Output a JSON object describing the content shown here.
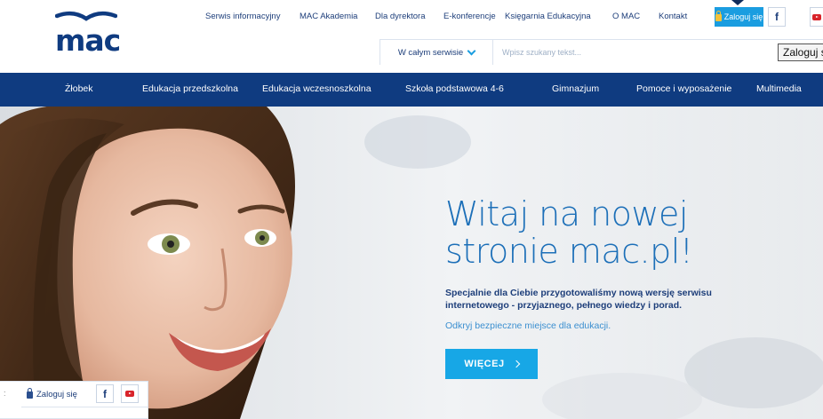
{
  "brand": {
    "logo_text": "mac",
    "primary_color": "#0f3b80",
    "accent_color": "#17a7e6"
  },
  "topnav": {
    "items": [
      "Serwis informacyjny",
      "MAC Akademia",
      "Dla dyrektora",
      "E-konferencje",
      "Księgarnia Edukacyjna",
      "O MAC",
      "Kontakt"
    ],
    "login_label": "Zaloguj się",
    "facebook_icon": "facebook-icon",
    "youtube_icon": "youtube-icon"
  },
  "search": {
    "scope_label": "W całym serwisie",
    "placeholder": "Wpisz szukany tekst...",
    "login_box_text": "Zaloguj się"
  },
  "mainnav": {
    "items": [
      "Żłobek",
      "Edukacja przedszkolna",
      "Edukacja wczesnoszkolna",
      "Szkoła podstawowa 4-6",
      "Gimnazjum",
      "Pomoce i wyposażenie",
      "Multimedia"
    ]
  },
  "hero": {
    "title_line1": "Witaj na nowej",
    "title_line2": "stronie mac.pl!",
    "text_line1": "Specjalnie dla Ciebie przygotowaliśmy nową wersję serwisu",
    "text_line2": "internetowego - przyjaznego, pełnego wiedzy i porad.",
    "subtext": "Odkryj bezpieczne miejsce dla edukacji.",
    "button_label": "WIĘCEJ"
  },
  "floating": {
    "login_label": "Zaloguj się",
    "fb_glyph": "f"
  }
}
